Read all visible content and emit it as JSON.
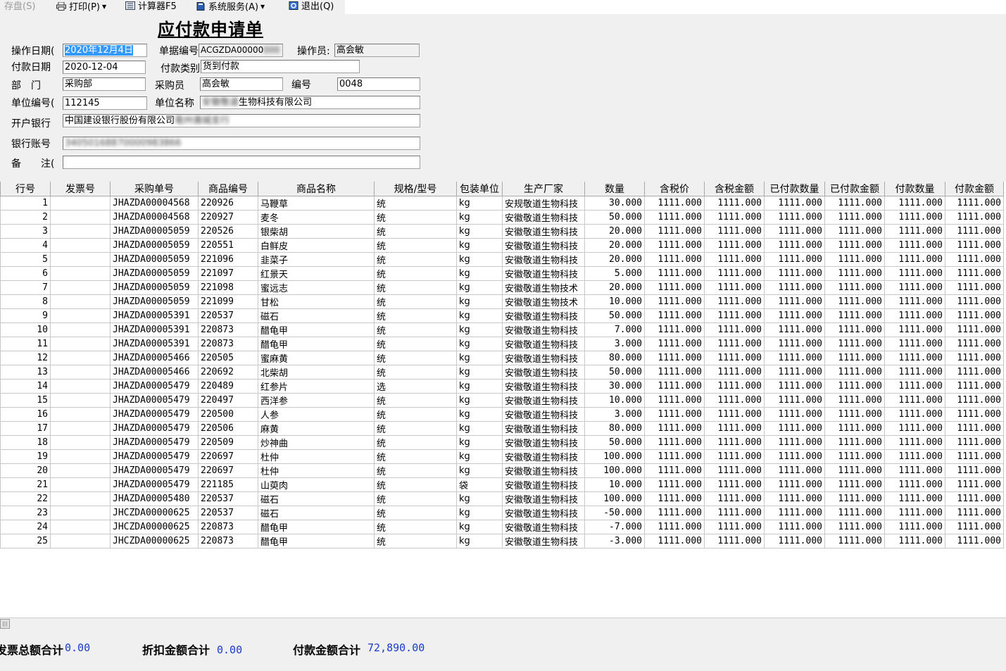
{
  "menu": {
    "save": "存盘(S)",
    "print": "打印(P)",
    "calculator": "计算器F5",
    "system_service": "系统服务(A)",
    "exit": "退出(Q)"
  },
  "form": {
    "title": "应付款申请单",
    "op_date_label": "操作日期(",
    "op_date_value": "2020年12月4日",
    "doc_no_label": "单据编号",
    "doc_no_value": "ACGZDA00000",
    "operator_label": "操作员:",
    "operator_value": "高会敏",
    "pay_date_label": "付款日期",
    "pay_date_value": "2020-12-04",
    "pay_type_label": "付款类别",
    "pay_type_value": "货到付款",
    "dept_label": "部　门",
    "dept_value": "采购部",
    "buyer_label": "采购员",
    "buyer_value": "高会敏",
    "code_label": "编号",
    "code_value": "0048",
    "unit_code_label": "单位编号(",
    "unit_code_value": "112145",
    "unit_name_label": "单位名称",
    "unit_name_hidden": "安徽敬道",
    "unit_name_value": "生物科技有限公司",
    "bank_label": "开户银行",
    "bank_value": "中国建设银行股份有限公司",
    "bank_hidden": "亳州谯城支行",
    "account_label": "银行账号",
    "account_hidden": "34050168870000983866",
    "remark_label": "备　　注(",
    "remark_value": ""
  },
  "table": {
    "headers": [
      "行号",
      "发票号",
      "采购单号",
      "商品编号",
      "商品名称",
      "规格/型号",
      "包装单位",
      "生产厂家",
      "数量",
      "含税价",
      "含税金额",
      "已付款数量",
      "已付款金额",
      "付款数量",
      "付款金额"
    ],
    "rows": [
      [
        "1",
        "",
        "JHAZDA00004568",
        "220926",
        "马鞭草",
        "统",
        "kg",
        "安规敬道生物科技",
        "30.000",
        "1111.000",
        "1111.000",
        "1111.000",
        "1111.000",
        "1111.000",
        "1111.000"
      ],
      [
        "2",
        "",
        "JHAZDA00004568",
        "220927",
        "麦冬",
        "统",
        "kg",
        "安徽敬道生物科技",
        "50.000",
        "1111.000",
        "1111.000",
        "1111.000",
        "1111.000",
        "1111.000",
        "1111.000"
      ],
      [
        "3",
        "",
        "JHAZDA00005059",
        "220526",
        "银柴胡",
        "统",
        "kg",
        "安徽敬道生物科技",
        "20.000",
        "1111.000",
        "1111.000",
        "1111.000",
        "1111.000",
        "1111.000",
        "1111.000"
      ],
      [
        "4",
        "",
        "JHAZDA00005059",
        "220551",
        "白鲜皮",
        "统",
        "kg",
        "安徽敬道生物科技",
        "20.000",
        "1111.000",
        "1111.000",
        "1111.000",
        "1111.000",
        "1111.000",
        "1111.000"
      ],
      [
        "5",
        "",
        "JHAZDA00005059",
        "221096",
        "韭菜子",
        "统",
        "kg",
        "安徽敬道生物科技",
        "20.000",
        "1111.000",
        "1111.000",
        "1111.000",
        "1111.000",
        "1111.000",
        "1111.000"
      ],
      [
        "6",
        "",
        "JHAZDA00005059",
        "221097",
        "红景天",
        "统",
        "kg",
        "安徽敬道生物科技",
        "5.000",
        "1111.000",
        "1111.000",
        "1111.000",
        "1111.000",
        "1111.000",
        "1111.000"
      ],
      [
        "7",
        "",
        "JHAZDA00005059",
        "221098",
        "蜜远志",
        "统",
        "kg",
        "安徽敬道生物技术",
        "20.000",
        "1111.000",
        "1111.000",
        "1111.000",
        "1111.000",
        "1111.000",
        "1111.000"
      ],
      [
        "8",
        "",
        "JHAZDA00005059",
        "221099",
        "甘松",
        "统",
        "kg",
        "安徽敬道生物技术",
        "10.000",
        "1111.000",
        "1111.000",
        "1111.000",
        "1111.000",
        "1111.000",
        "1111.000"
      ],
      [
        "9",
        "",
        "JHAZDA00005391",
        "220537",
        "磁石",
        "统",
        "kg",
        "安徽敬道生物科技",
        "50.000",
        "1111.000",
        "1111.000",
        "1111.000",
        "1111.000",
        "1111.000",
        "1111.000"
      ],
      [
        "10",
        "",
        "JHAZDA00005391",
        "220873",
        "醋龟甲",
        "统",
        "kg",
        "安徽敬道生物科技",
        "7.000",
        "1111.000",
        "1111.000",
        "1111.000",
        "1111.000",
        "1111.000",
        "1111.000"
      ],
      [
        "11",
        "",
        "JHAZDA00005391",
        "220873",
        "醋龟甲",
        "统",
        "kg",
        "安徽敬道生物科技",
        "3.000",
        "1111.000",
        "1111.000",
        "1111.000",
        "1111.000",
        "1111.000",
        "1111.000"
      ],
      [
        "12",
        "",
        "JHAZDA00005466",
        "220505",
        "蜜麻黄",
        "统",
        "kg",
        "安徽敬道生物科技",
        "80.000",
        "1111.000",
        "1111.000",
        "1111.000",
        "1111.000",
        "1111.000",
        "1111.000"
      ],
      [
        "13",
        "",
        "JHAZDA00005466",
        "220692",
        "北柴胡",
        "统",
        "kg",
        "安徽敬道生物科技",
        "50.000",
        "1111.000",
        "1111.000",
        "1111.000",
        "1111.000",
        "1111.000",
        "1111.000"
      ],
      [
        "14",
        "",
        "JHAZDA00005479",
        "220489",
        "红参片",
        "选",
        "kg",
        "安徽敬道生物科技",
        "30.000",
        "1111.000",
        "1111.000",
        "1111.000",
        "1111.000",
        "1111.000",
        "1111.000"
      ],
      [
        "15",
        "",
        "JHAZDA00005479",
        "220497",
        "西洋参",
        "统",
        "kg",
        "安徽敬道生物科技",
        "10.000",
        "1111.000",
        "1111.000",
        "1111.000",
        "1111.000",
        "1111.000",
        "1111.000"
      ],
      [
        "16",
        "",
        "JHAZDA00005479",
        "220500",
        "人参",
        "统",
        "kg",
        "安徽敬道生物科技",
        "3.000",
        "1111.000",
        "1111.000",
        "1111.000",
        "1111.000",
        "1111.000",
        "1111.000"
      ],
      [
        "17",
        "",
        "JHAZDA00005479",
        "220506",
        "麻黄",
        "统",
        "kg",
        "安徽敬道生物科技",
        "80.000",
        "1111.000",
        "1111.000",
        "1111.000",
        "1111.000",
        "1111.000",
        "1111.000"
      ],
      [
        "18",
        "",
        "JHAZDA00005479",
        "220509",
        "炒神曲",
        "统",
        "kg",
        "安徽敬道生物科技",
        "50.000",
        "1111.000",
        "1111.000",
        "1111.000",
        "1111.000",
        "1111.000",
        "1111.000"
      ],
      [
        "19",
        "",
        "JHAZDA00005479",
        "220697",
        "杜仲",
        "统",
        "kg",
        "安徽敬道生物科技",
        "100.000",
        "1111.000",
        "1111.000",
        "1111.000",
        "1111.000",
        "1111.000",
        "1111.000"
      ],
      [
        "20",
        "",
        "JHAZDA00005479",
        "220697",
        "杜仲",
        "统",
        "kg",
        "安徽敬道生物科技",
        "100.000",
        "1111.000",
        "1111.000",
        "1111.000",
        "1111.000",
        "1111.000",
        "1111.000"
      ],
      [
        "21",
        "",
        "JHAZDA00005479",
        "221185",
        "山萸肉",
        "统",
        "袋",
        "安徽敬道生物科技",
        "10.000",
        "1111.000",
        "1111.000",
        "1111.000",
        "1111.000",
        "1111.000",
        "1111.000"
      ],
      [
        "22",
        "",
        "JHAZDA00005480",
        "220537",
        "磁石",
        "统",
        "kg",
        "安徽敬道生物科技",
        "100.000",
        "1111.000",
        "1111.000",
        "1111.000",
        "1111.000",
        "1111.000",
        "1111.000"
      ],
      [
        "23",
        "",
        "JHCZDA00000625",
        "220537",
        "磁石",
        "统",
        "kg",
        "安徽敬道生物科技",
        "-50.000",
        "1111.000",
        "1111.000",
        "1111.000",
        "1111.000",
        "1111.000",
        "1111.000"
      ],
      [
        "24",
        "",
        "JHCZDA00000625",
        "220873",
        "醋龟甲",
        "统",
        "kg",
        "安徽敬道生物科技",
        "-7.000",
        "1111.000",
        "1111.000",
        "1111.000",
        "1111.000",
        "1111.000",
        "1111.000"
      ],
      [
        "25",
        "",
        "JHCZDA00000625",
        "220873",
        "醋龟甲",
        "统",
        "kg",
        "安徽敬道生物科技",
        "-3.000",
        "1111.000",
        "1111.000",
        "1111.000",
        "1111.000",
        "1111.000",
        "1111.000"
      ]
    ]
  },
  "footer": {
    "invoice_total_label": "发票总额合计",
    "invoice_total_value": "0.00",
    "discount_total_label": "折扣金额合计",
    "discount_total_value": "0.00",
    "payment_total_label": "付款金额合计",
    "payment_total_value": "72,890.00"
  }
}
